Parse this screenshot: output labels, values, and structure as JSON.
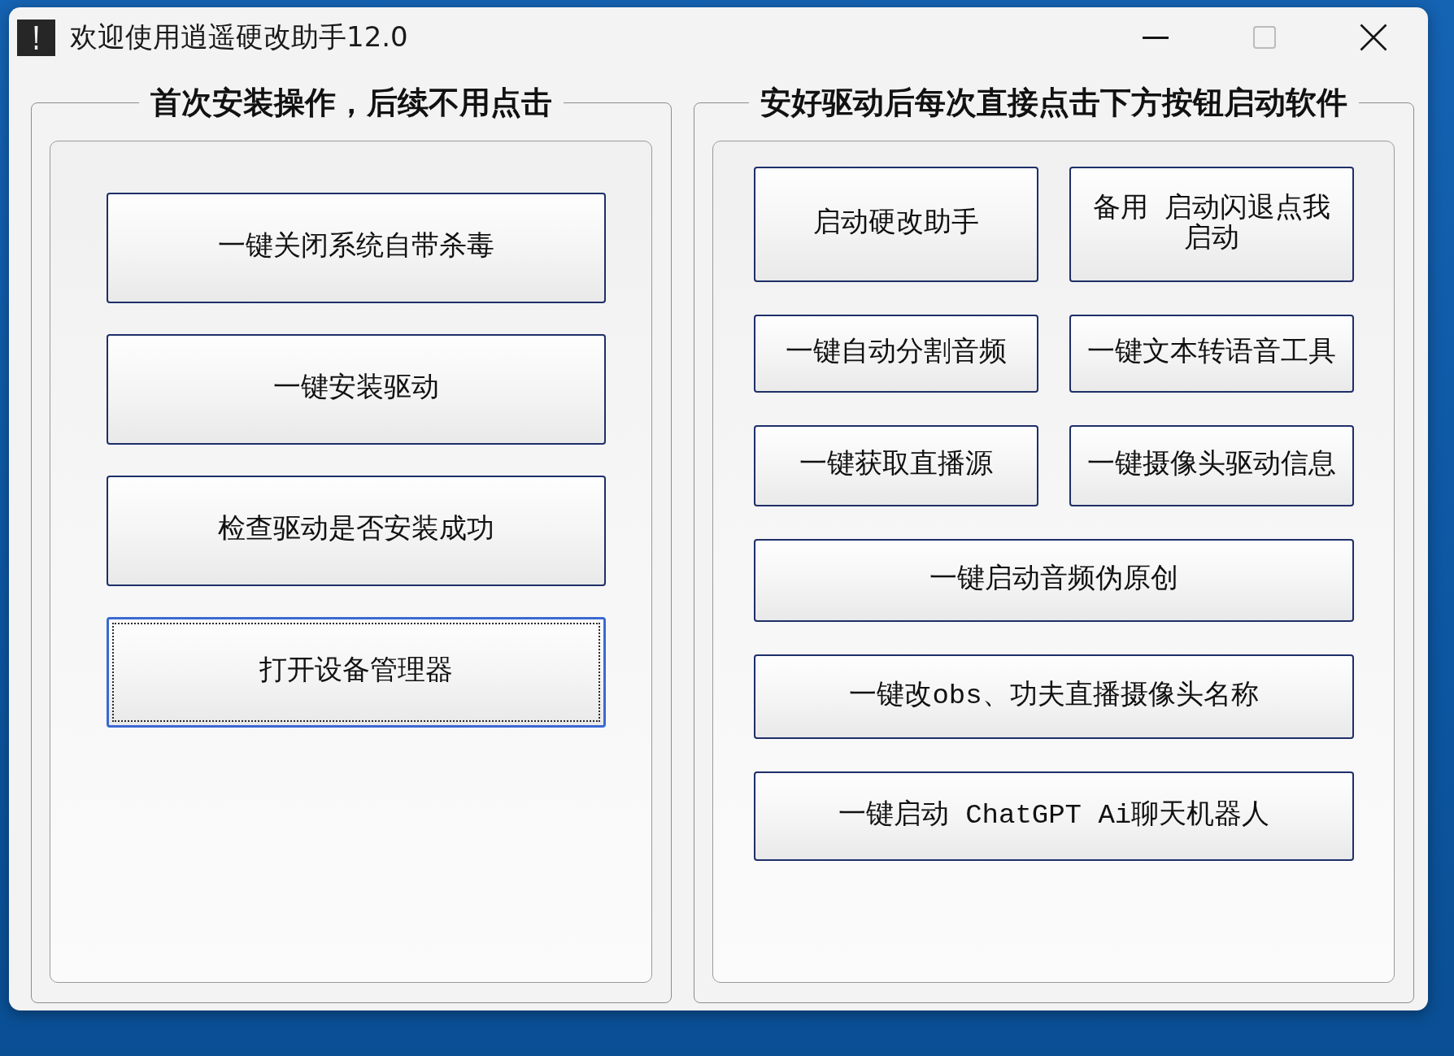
{
  "window": {
    "title": "欢迎使用逍遥硬改助手12.0",
    "controls": [
      {
        "kind": "minimize",
        "disabled": false
      },
      {
        "kind": "maximize",
        "disabled": true
      },
      {
        "kind": "close",
        "disabled": false
      }
    ]
  },
  "left_group": {
    "title": "首次安装操作，后续不用点击",
    "buttons": [
      {
        "label": "一键关闭系统自带杀毒",
        "focused": false
      },
      {
        "label": "一键安装驱动",
        "focused": false
      },
      {
        "label": "检查驱动是否安装成功",
        "focused": false
      },
      {
        "label": "打开设备管理器",
        "focused": true
      }
    ]
  },
  "right_group": {
    "title": "安好驱动后每次直接点击下方按钮启动软件",
    "button_rows": [
      [
        {
          "label": "启动硬改助手",
          "focused": false
        },
        {
          "label": "备用 启动闪退点我启动",
          "focused": false
        }
      ],
      [
        {
          "label": "一键自动分割音频",
          "focused": false
        },
        {
          "label": "一键文本转语音工具",
          "focused": false
        }
      ],
      [
        {
          "label": "一键获取直播源",
          "focused": false
        },
        {
          "label": "一键摄像头驱动信息",
          "focused": false
        }
      ],
      [
        {
          "label": "一键启动音频伪原创",
          "focused": false
        }
      ],
      [
        {
          "label": "一键改obs、功夫直播摄像头名称",
          "focused": false
        }
      ],
      [
        {
          "label": "一键启动 ChatGPT Ai聊天机器人",
          "focused": false
        }
      ]
    ]
  }
}
